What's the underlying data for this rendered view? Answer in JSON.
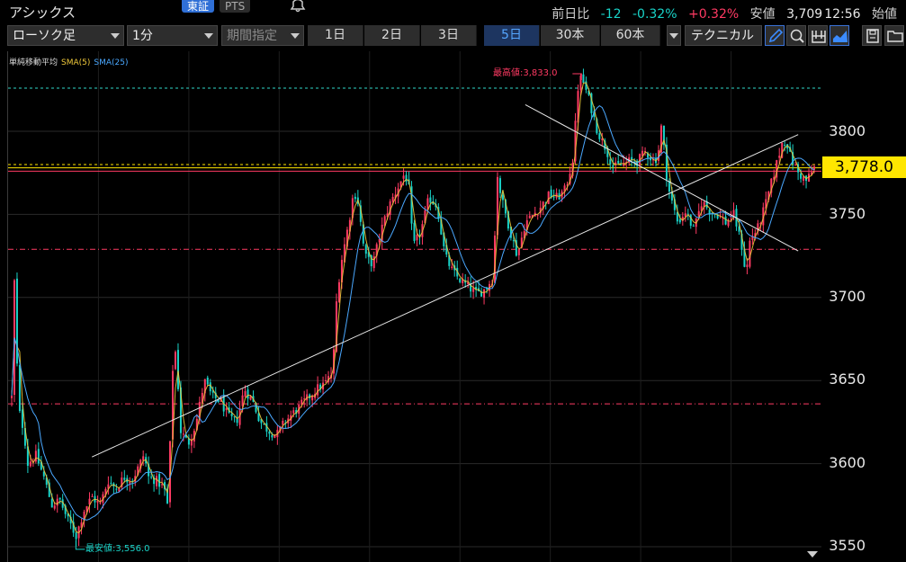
{
  "header": {
    "title": "アシックス",
    "market_tabs": [
      "東証",
      "PTS"
    ],
    "quote": {
      "change_label": "前日比",
      "change": "-12",
      "change_pct": "-0.32%",
      "cur_pct": "+0.32%",
      "low_label": "安値",
      "low": "3,709",
      "time": "12:56",
      "open_label": "始値"
    }
  },
  "toolbar": {
    "chart_type": "ローソク足",
    "interval": "1分",
    "period": "期間指定",
    "ranges": [
      "1日",
      "2日",
      "3日",
      "5日",
      "30本",
      "60本"
    ],
    "active_range": "5日",
    "technical": "テクニカル",
    "icons": [
      "pen-icon",
      "zoom-icon",
      "output-icon",
      "chart-style-icon",
      "save-icon",
      "folder-icon"
    ]
  },
  "legend": {
    "title": "単純移動平均",
    "sma5": "SMA(5)",
    "sma25": "SMA(25)"
  },
  "colors": {
    "up": "#ff3a63",
    "down": "#19d3c8",
    "sma5": "#f0c93b",
    "sma25": "#4aa8ff",
    "price_tag": "#ffe600"
  },
  "annotations": {
    "high": "最高値:3,833.0",
    "low": "最安値:3,556.0",
    "current_price": "3,778.0"
  },
  "chart_data": {
    "type": "candlestick",
    "ylim": [
      3545,
      3845
    ],
    "yticks": [
      3550,
      3600,
      3650,
      3700,
      3750,
      3800
    ],
    "ytick_labels": [
      "3550",
      "3600",
      "3650",
      "3700",
      "3750",
      "3800"
    ],
    "hlines": [
      {
        "value": 3826,
        "color": "#2fd6c8",
        "style": "dashed"
      },
      {
        "value": 3780,
        "color": "#ffe600",
        "style": "dashed"
      },
      {
        "value": 3778,
        "color": "#ffe600",
        "style": "solid"
      },
      {
        "value": 3776,
        "color": "#ff3a63",
        "style": "solid"
      },
      {
        "value": 3729,
        "color": "#ff3a63",
        "style": "dashdot"
      },
      {
        "value": 3636,
        "color": "#ff3a63",
        "style": "dashdot"
      }
    ],
    "trendlines": [
      {
        "x": [
          0.1,
          0.98
        ],
        "y": [
          3604,
          3798
        ]
      },
      {
        "x": [
          0.64,
          0.98
        ],
        "y": [
          3816,
          3728
        ]
      }
    ],
    "path": [
      [
        0.0,
        3640
      ],
      [
        0.003,
        3715
      ],
      [
        0.006,
        3665
      ],
      [
        0.01,
        3630
      ],
      [
        0.015,
        3620
      ],
      [
        0.02,
        3600
      ],
      [
        0.03,
        3605
      ],
      [
        0.04,
        3592
      ],
      [
        0.05,
        3575
      ],
      [
        0.06,
        3578
      ],
      [
        0.07,
        3566
      ],
      [
        0.075,
        3562
      ],
      [
        0.08,
        3556
      ],
      [
        0.09,
        3572
      ],
      [
        0.1,
        3580
      ],
      [
        0.11,
        3575
      ],
      [
        0.12,
        3590
      ],
      [
        0.13,
        3585
      ],
      [
        0.14,
        3592
      ],
      [
        0.15,
        3590
      ],
      [
        0.16,
        3600
      ],
      [
        0.165,
        3606
      ],
      [
        0.17,
        3592
      ],
      [
        0.18,
        3590
      ],
      [
        0.19,
        3585
      ],
      [
        0.195,
        3573
      ],
      [
        0.2,
        3655
      ],
      [
        0.205,
        3670
      ],
      [
        0.21,
        3620
      ],
      [
        0.22,
        3612
      ],
      [
        0.23,
        3625
      ],
      [
        0.24,
        3650
      ],
      [
        0.25,
        3640
      ],
      [
        0.26,
        3638
      ],
      [
        0.27,
        3628
      ],
      [
        0.28,
        3625
      ],
      [
        0.29,
        3645
      ],
      [
        0.3,
        3638
      ],
      [
        0.31,
        3625
      ],
      [
        0.32,
        3620
      ],
      [
        0.33,
        3617
      ],
      [
        0.34,
        3625
      ],
      [
        0.35,
        3630
      ],
      [
        0.36,
        3635
      ],
      [
        0.37,
        3640
      ],
      [
        0.38,
        3645
      ],
      [
        0.39,
        3648
      ],
      [
        0.4,
        3655
      ],
      [
        0.405,
        3700
      ],
      [
        0.41,
        3720
      ],
      [
        0.42,
        3745
      ],
      [
        0.425,
        3760
      ],
      [
        0.43,
        3763
      ],
      [
        0.44,
        3725
      ],
      [
        0.45,
        3720
      ],
      [
        0.46,
        3740
      ],
      [
        0.47,
        3755
      ],
      [
        0.48,
        3765
      ],
      [
        0.49,
        3775
      ],
      [
        0.495,
        3765
      ],
      [
        0.5,
        3730
      ],
      [
        0.51,
        3740
      ],
      [
        0.52,
        3760
      ],
      [
        0.53,
        3755
      ],
      [
        0.54,
        3725
      ],
      [
        0.55,
        3715
      ],
      [
        0.56,
        3710
      ],
      [
        0.57,
        3706
      ],
      [
        0.58,
        3702
      ],
      [
        0.59,
        3705
      ],
      [
        0.6,
        3712
      ],
      [
        0.605,
        3775
      ],
      [
        0.61,
        3760
      ],
      [
        0.62,
        3742
      ],
      [
        0.63,
        3725
      ],
      [
        0.64,
        3745
      ],
      [
        0.65,
        3750
      ],
      [
        0.66,
        3755
      ],
      [
        0.67,
        3762
      ],
      [
        0.68,
        3760
      ],
      [
        0.69,
        3765
      ],
      [
        0.7,
        3785
      ],
      [
        0.705,
        3825
      ],
      [
        0.71,
        3833
      ],
      [
        0.72,
        3818
      ],
      [
        0.73,
        3800
      ],
      [
        0.74,
        3790
      ],
      [
        0.75,
        3778
      ],
      [
        0.76,
        3780
      ],
      [
        0.77,
        3782
      ],
      [
        0.78,
        3782
      ],
      [
        0.79,
        3788
      ],
      [
        0.8,
        3782
      ],
      [
        0.805,
        3785
      ],
      [
        0.81,
        3805
      ],
      [
        0.815,
        3777
      ],
      [
        0.82,
        3762
      ],
      [
        0.83,
        3745
      ],
      [
        0.84,
        3752
      ],
      [
        0.85,
        3740
      ],
      [
        0.86,
        3758
      ],
      [
        0.87,
        3752
      ],
      [
        0.88,
        3750
      ],
      [
        0.89,
        3745
      ],
      [
        0.9,
        3750
      ],
      [
        0.91,
        3730
      ],
      [
        0.915,
        3713
      ],
      [
        0.92,
        3735
      ],
      [
        0.93,
        3742
      ],
      [
        0.94,
        3757
      ],
      [
        0.95,
        3775
      ],
      [
        0.96,
        3793
      ],
      [
        0.965,
        3795
      ],
      [
        0.97,
        3785
      ],
      [
        0.98,
        3775
      ],
      [
        0.99,
        3770
      ],
      [
        1.0,
        3778
      ]
    ]
  }
}
